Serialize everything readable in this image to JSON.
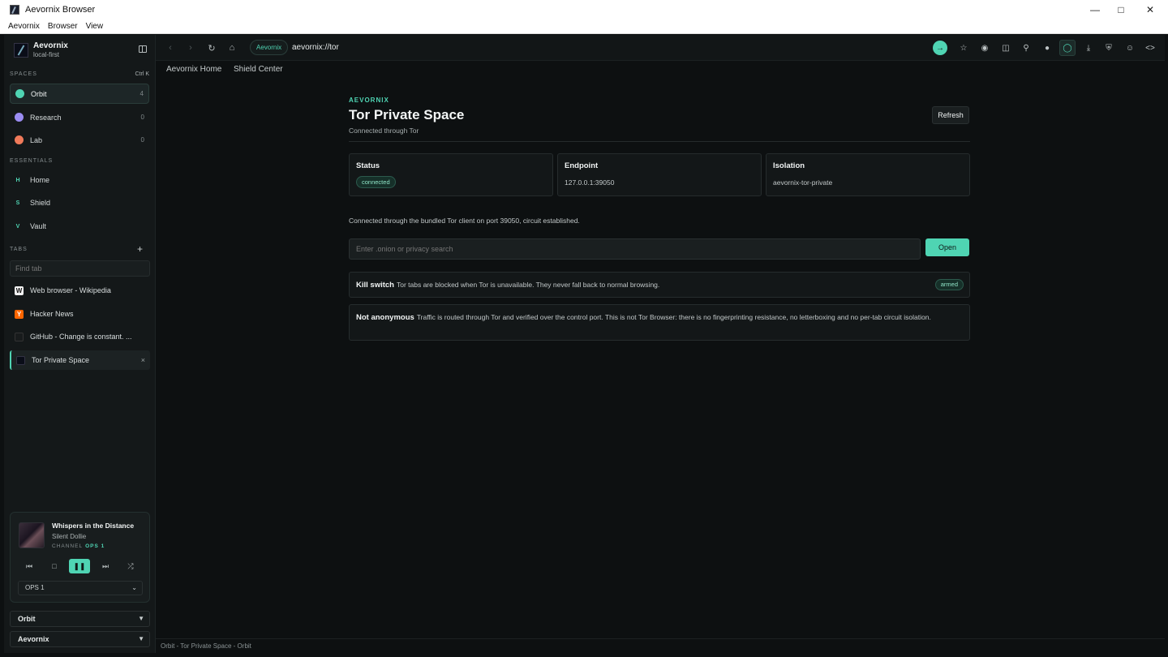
{
  "window": {
    "title": "Aevornix Browser"
  },
  "menu": [
    "Aevornix",
    "Browser",
    "View"
  ],
  "brand": {
    "name": "Aevornix",
    "subtitle": "local-first"
  },
  "spaces": {
    "label": "SPACES",
    "shortcut": "Ctrl K",
    "items": [
      {
        "name": "Orbit",
        "count": "4",
        "color": "#4fd4b3"
      },
      {
        "name": "Research",
        "count": "0",
        "color": "#9b8cf2"
      },
      {
        "name": "Lab",
        "count": "0",
        "color": "#f07a5a"
      }
    ]
  },
  "essentials": {
    "label": "ESSENTIALS",
    "items": [
      {
        "letter": "H",
        "name": "Home"
      },
      {
        "letter": "S",
        "name": "Shield"
      },
      {
        "letter": "V",
        "name": "Vault"
      }
    ]
  },
  "tabs": {
    "label": "TABS",
    "find_placeholder": "Find tab",
    "items": [
      {
        "favicon": "W",
        "title": "Web browser - Wikipedia"
      },
      {
        "favicon": "Y",
        "title": "Hacker News"
      },
      {
        "favicon": "",
        "title": "GitHub - Change is constant. ..."
      },
      {
        "favicon": "",
        "title": "Tor Private Space",
        "close": "×"
      }
    ]
  },
  "player": {
    "song": "Whispers in the Distance",
    "artist": "Silent Dollie",
    "channel_label": "CHANNEL",
    "channel": "OPS 1",
    "selected_channel": "OPS 1"
  },
  "selectors": {
    "space": "Orbit",
    "profile": "Aevornix"
  },
  "navbar": {
    "badge": "Aevornix",
    "url": "aevornix://tor"
  },
  "bookmarks": [
    "Aevornix Home",
    "Shield Center"
  ],
  "page": {
    "kicker": "AEVORNIX",
    "title": "Tor Private Space",
    "subtitle": "Connected through Tor",
    "refresh": "Refresh",
    "cards": [
      {
        "label": "Status",
        "value": "connected"
      },
      {
        "label": "Endpoint",
        "value": "127.0.0.1:39050"
      },
      {
        "label": "Isolation",
        "value": "aevornix-tor-private"
      }
    ],
    "note": "Connected through the bundled Tor client on port 39050, circuit established.",
    "search_placeholder": "Enter .onion or privacy search",
    "open": "Open",
    "killswitch": {
      "title": "Kill switch",
      "text": "Tor tabs are blocked when Tor is unavailable. They never fall back to normal browsing.",
      "badge": "armed"
    },
    "anonymity": {
      "title": "Not anonymous",
      "text": "Traffic is routed through Tor and verified over the control port. This is not Tor Browser: there is no fingerprinting resistance, no letterboxing and no per-tab circuit isolation."
    }
  },
  "statusbar": "Orbit - Tor Private Space - Orbit"
}
